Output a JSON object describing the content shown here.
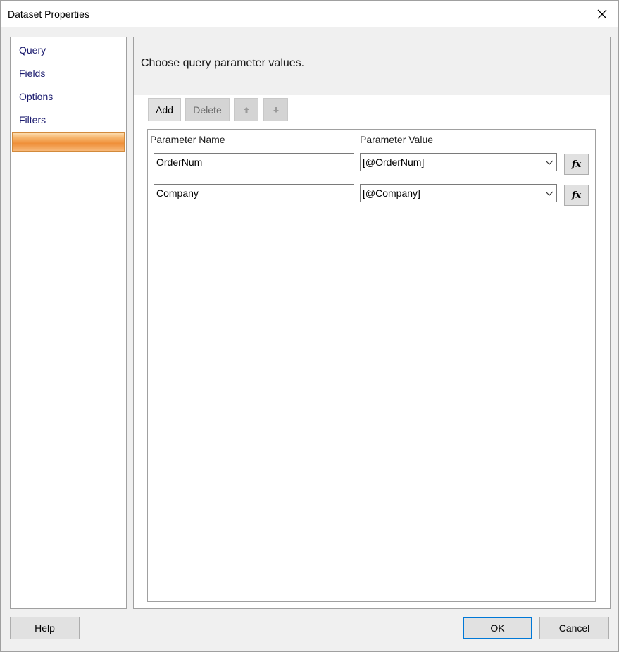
{
  "window": {
    "title": "Dataset Properties",
    "close_icon": "close-icon"
  },
  "nav": {
    "items": [
      {
        "label": "Query"
      },
      {
        "label": "Fields"
      },
      {
        "label": "Options"
      },
      {
        "label": "Filters"
      },
      {
        "label": ""
      }
    ],
    "selected_index": 4
  },
  "content": {
    "heading": "Choose query parameter values.",
    "toolbar": {
      "add_label": "Add",
      "delete_label": "Delete",
      "move_up_icon": "arrow-up-icon",
      "move_down_icon": "arrow-down-icon"
    },
    "grid": {
      "columns": [
        "Parameter Name",
        "Parameter Value"
      ],
      "rows": [
        {
          "name": "OrderNum",
          "value": "[@OrderNum]",
          "expr_label": "fx"
        },
        {
          "name": "Company",
          "value": "[@Company]",
          "expr_label": "fx"
        }
      ]
    }
  },
  "footer": {
    "help_label": "Help",
    "ok_label": "OK",
    "cancel_label": "Cancel"
  },
  "colors": {
    "selected_nav": "#ef8f38",
    "default_button_border": "#0078d7",
    "nav_link": "#1a1a6e"
  }
}
